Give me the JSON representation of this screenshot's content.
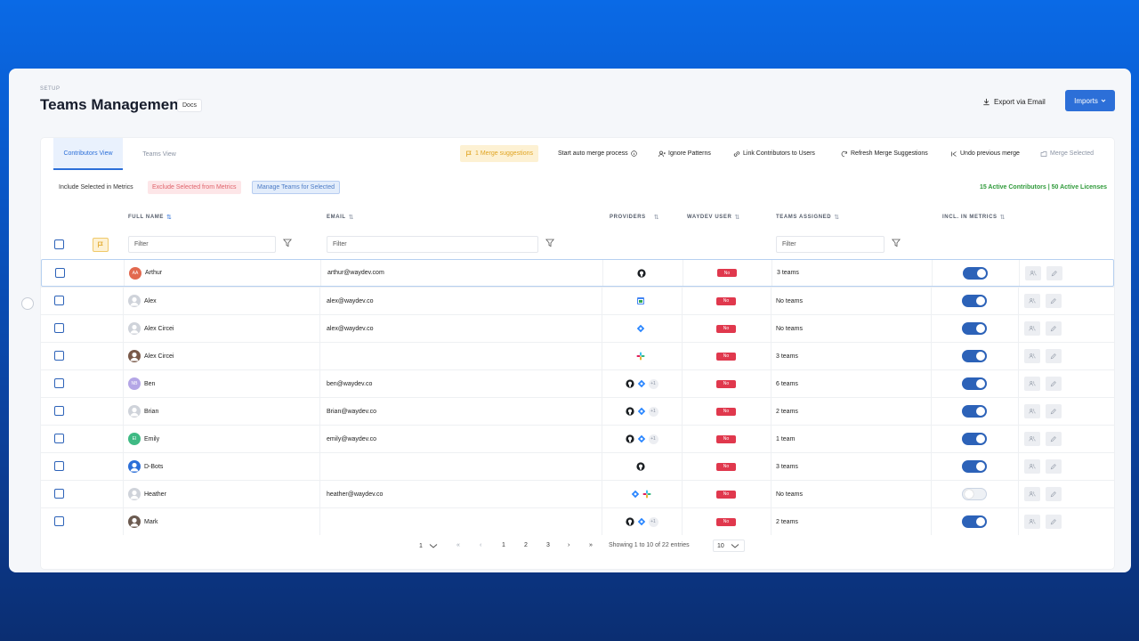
{
  "header": {
    "breadcrumb": "SETUP",
    "title": "Teams Management",
    "docs": "Docs",
    "export": "Export via Email",
    "imports": "Imports"
  },
  "tabs": [
    "Contributors View",
    "Teams View"
  ],
  "toolbar": {
    "merge_suggestions": "1 Merge suggestions",
    "auto_merge": "Start auto merge process",
    "ignore_patterns": "Ignore Patterns",
    "link_contributors": "Link Contributors to Users",
    "refresh": "Refresh Merge Suggestions",
    "undo": "Undo previous merge",
    "merge_selected": "Merge Selected"
  },
  "metrics_bar": {
    "include_label": "Include Selected in Metrics",
    "exclude_label": "Exclude Selected from Metrics",
    "manage_label": "Manage Teams for Selected",
    "summary": "15 Active Contributors | 50 Active Licenses"
  },
  "columns": {
    "full_name": "FULL NAME",
    "email": "EMAIL",
    "providers": "PROVIDERS",
    "waydev_user": "WAYDEV USER",
    "teams": "TEAMS ASSIGNED",
    "incl": "INCL. IN METRICS"
  },
  "filter_placeholder": "Filter",
  "no_label": "No",
  "rows": [
    {
      "name": "Arthur",
      "initials": "AA",
      "avatar_color": "#e2694f",
      "email": "arthur@waydev.com",
      "providers": [
        "github"
      ],
      "teams": "3 teams",
      "incl": true
    },
    {
      "name": "Alex",
      "initials": "",
      "avatar_color": "#cfd3da",
      "email": "alex@waydev.co",
      "providers": [
        "calendar"
      ],
      "teams": "No teams",
      "incl": true
    },
    {
      "name": "Alex Circei",
      "initials": "",
      "avatar_color": "#cfd3da",
      "email": "alex@waydev.co",
      "providers": [
        "jira"
      ],
      "teams": "No teams",
      "incl": true
    },
    {
      "name": "Alex Circei",
      "initials": "",
      "avatar_color": "#7a5a4a",
      "email": "",
      "providers": [
        "slack"
      ],
      "teams": "3 teams",
      "incl": true
    },
    {
      "name": "Ben",
      "initials": "NB",
      "avatar_color": "#b4a6e6",
      "email": "ben@waydev.co",
      "providers": [
        "github",
        "jira",
        "+1"
      ],
      "teams": "6 teams",
      "incl": true
    },
    {
      "name": "Brian",
      "initials": "",
      "avatar_color": "#cfd3da",
      "email": "Brian@waydev.co",
      "providers": [
        "github",
        "jira",
        "+1"
      ],
      "teams": "2 teams",
      "incl": true
    },
    {
      "name": "Emily",
      "initials": "EI",
      "avatar_color": "#3fba84",
      "email": "emily@waydev.co",
      "providers": [
        "github",
        "jira",
        "+1"
      ],
      "teams": "1 team",
      "incl": true
    },
    {
      "name": "D-Bots",
      "initials": "",
      "avatar_color": "#2c6fd8",
      "email": "",
      "providers": [
        "github"
      ],
      "teams": "3 teams",
      "incl": true
    },
    {
      "name": "Heather",
      "initials": "",
      "avatar_color": "#cfd3da",
      "email": "heather@waydev.co",
      "providers": [
        "jira",
        "slack"
      ],
      "teams": "No teams",
      "incl": false
    },
    {
      "name": "Mark",
      "initials": "",
      "avatar_color": "#6b5a50",
      "email": "",
      "providers": [
        "github",
        "jira",
        "+1"
      ],
      "teams": "2 teams",
      "incl": true
    }
  ],
  "pagination": {
    "page_select": "1",
    "pages": [
      "1",
      "2",
      "3"
    ],
    "showing": "Showing 1 to 10 of 22 entries",
    "page_size": "10"
  }
}
